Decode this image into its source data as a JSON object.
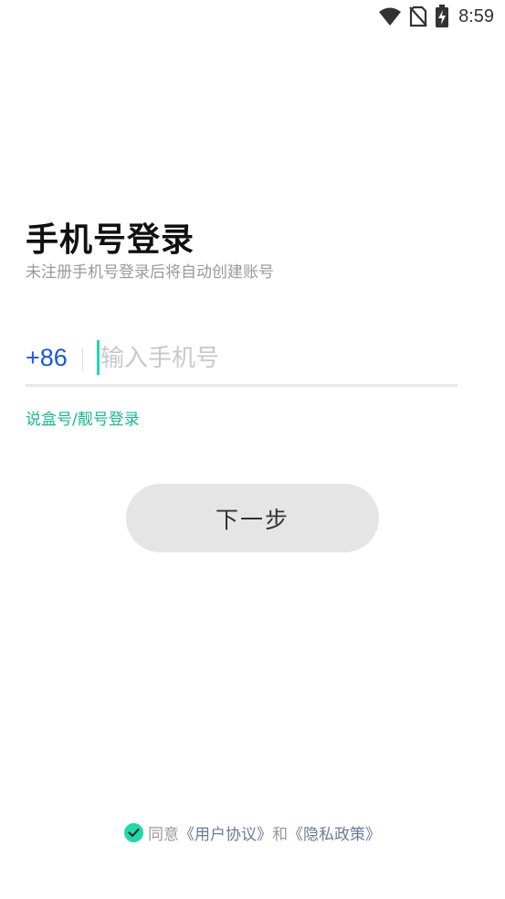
{
  "status_bar": {
    "time": "8:59",
    "icons": [
      "wifi-icon",
      "no-sim-icon",
      "battery-charging-icon"
    ]
  },
  "login": {
    "title": "手机号登录",
    "subtitle": "未注册手机号登录后将自动创建账号",
    "country_code": "+86",
    "phone_placeholder": "输入手机号",
    "phone_value": "",
    "alt_login_label": "说盒号/靓号登录",
    "next_button_label": "下一步"
  },
  "agreement": {
    "checked": true,
    "prefix": "同意",
    "user_agreement": "《用户协议》",
    "conjunction": "和",
    "privacy_policy": "《隐私政策》"
  },
  "colors": {
    "accent_blue": "#1a56e8",
    "accent_green": "#17b893",
    "cursor_teal": "#20d8b0",
    "check_green": "#1ed9a8",
    "button_bg": "#e5e5e5"
  }
}
